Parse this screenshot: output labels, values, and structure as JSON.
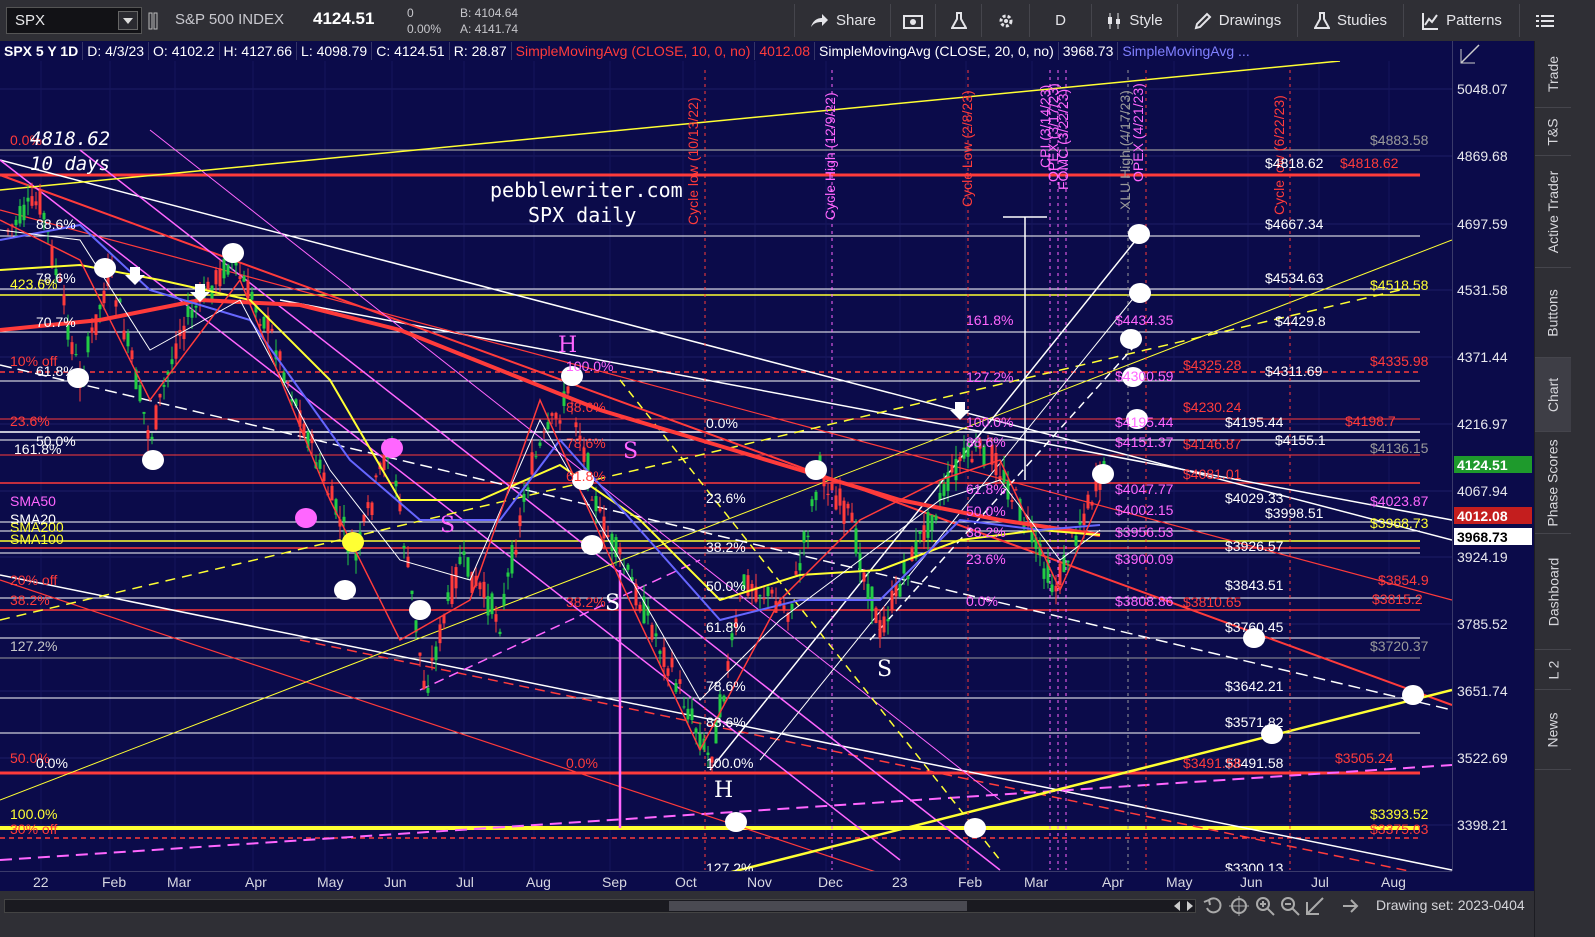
{
  "toolbar": {
    "symbol": "SPX",
    "index_name": "S&P 500 INDEX",
    "last": "4124.51",
    "change": "0",
    "change_pct": "0.00%",
    "bid": "B: 4104.64",
    "ask": "A: 4141.74",
    "share_label": "Share",
    "period_label": "D",
    "style_label": "Style",
    "drawings_label": "Drawings",
    "studies_label": "Studies",
    "patterns_label": "Patterns"
  },
  "info_bar": {
    "chart_desc": "SPX 5 Y 1D",
    "date": "D: 4/3/23",
    "open": "O: 4102.2",
    "high": "H: 4127.66",
    "low": "L: 4098.79",
    "close": "C: 4124.51",
    "range": "R: 28.87",
    "sma10": "SimpleMovingAvg (CLOSE, 10, 0, no)",
    "sma10_val": "4012.08",
    "sma20": "SimpleMovingAvg (CLOSE, 20, 0, no)",
    "sma20_val": "3968.73",
    "sma_more": "SimpleMovingAvg ..."
  },
  "watermark": {
    "line1": "pebblewriter.com",
    "line2": "SPX daily"
  },
  "price_axis": {
    "ticks": [
      "5048.07",
      "4869.68",
      "4697.59",
      "4531.58",
      "4371.44",
      "4216.97",
      "4067.94",
      "3924.19",
      "3785.52",
      "3651.74",
      "3522.69",
      "3398.21"
    ],
    "tags": [
      {
        "text": "4124.51",
        "bg": "#1e9a2c",
        "color": "#ffffff"
      },
      {
        "text": "4012.08",
        "bg": "#c41e1e",
        "color": "#ffffff"
      },
      {
        "text": "3968.73",
        "bg": "#ffffff",
        "color": "#000000"
      }
    ]
  },
  "time_axis": [
    "22",
    "Feb",
    "Mar",
    "Apr",
    "May",
    "Jun",
    "Jul",
    "Aug",
    "Sep",
    "Oct",
    "Nov",
    "Dec",
    "23",
    "Feb",
    "Mar",
    "Apr",
    "May",
    "Jun",
    "Jul",
    "Aug"
  ],
  "cycle_labels": {
    "oct": "Cycle low (10/13/22)",
    "dec": "Cycle High (12/9/22)",
    "feb": "Cycle Low (2/8/23)",
    "cpi": "CPI (3/14/23)",
    "opex1": "OPEX (3/17/23)",
    "fomc": "FOMC (3/22/23)",
    "xlu": "XLU High (4/17/23)",
    "opex2": "OPEX (4/21/23)",
    "jun": "Cycle low (6/22/23)"
  },
  "levels_right": [
    {
      "text": "$4883.58",
      "color": "#9a9a9a"
    },
    {
      "text": "$4818.62",
      "color": "#ffffff"
    },
    {
      "text": "$4818.62",
      "color": "#ff3b3b"
    },
    {
      "text": "$4667.34",
      "color": "#ffffff"
    },
    {
      "text": "$4534.63",
      "color": "#ffffff"
    },
    {
      "text": "$4518.58",
      "color": "#ffff33"
    },
    {
      "text": "$4434.35",
      "color": "#ff66ff"
    },
    {
      "text": "$4429.8",
      "color": "#ffffff"
    },
    {
      "text": "$4335.98",
      "color": "#ff3b3b"
    },
    {
      "text": "$4325.28",
      "color": "#ff3b3b"
    },
    {
      "text": "$4311.69",
      "color": "#ffffff"
    },
    {
      "text": "$4300.59",
      "color": "#ff66ff"
    },
    {
      "text": "$4230.24",
      "color": "#ff3b3b"
    },
    {
      "text": "$4198.7",
      "color": "#ff3b3b"
    },
    {
      "text": "$4195.44",
      "color": "#ffffff"
    },
    {
      "text": "$4195.44",
      "color": "#ff66ff"
    },
    {
      "text": "$4155.1",
      "color": "#ffffff"
    },
    {
      "text": "$4151.37",
      "color": "#ff66ff"
    },
    {
      "text": "$4146.87",
      "color": "#ff3b3b"
    },
    {
      "text": "$4136.15",
      "color": "#9a9a9a"
    },
    {
      "text": "$4081.01",
      "color": "#ff3b3b"
    },
    {
      "text": "$4047.77",
      "color": "#ff66ff"
    },
    {
      "text": "$4029.33",
      "color": "#ffffff"
    },
    {
      "text": "$4023.87",
      "color": "#ff66ff"
    },
    {
      "text": "$4002.15",
      "color": "#ff66ff"
    },
    {
      "text": "$3998.51",
      "color": "#ffffff"
    },
    {
      "text": "$3968.73",
      "color": "#ffff33"
    },
    {
      "text": "$3956.53",
      "color": "#ff66ff"
    },
    {
      "text": "$3926.57",
      "color": "#ffffff"
    },
    {
      "text": "$3900.09",
      "color": "#ff66ff"
    },
    {
      "text": "$3854.9",
      "color": "#ff3b3b"
    },
    {
      "text": "$3843.51",
      "color": "#ffffff"
    },
    {
      "text": "$3815.2",
      "color": "#ff3b3b"
    },
    {
      "text": "$3810.65",
      "color": "#ff3b3b"
    },
    {
      "text": "$3808.86",
      "color": "#ff66ff"
    },
    {
      "text": "$3760.45",
      "color": "#ffffff"
    },
    {
      "text": "$3720.37",
      "color": "#9a9a9a"
    },
    {
      "text": "$3642.21",
      "color": "#ffffff"
    },
    {
      "text": "$3571.82",
      "color": "#ffffff"
    },
    {
      "text": "$3505.24",
      "color": "#ff3b3b"
    },
    {
      "text": "$3491.58",
      "color": "#ffffff"
    },
    {
      "text": "$3491.58",
      "color": "#ff3b3b"
    },
    {
      "text": "$3393.52",
      "color": "#ffff33"
    },
    {
      "text": "$3375.03",
      "color": "#ff3b3b"
    },
    {
      "text": "$3300.13",
      "color": "#ffffff"
    }
  ],
  "fib_labels": [
    {
      "text": "0.0%",
      "color": "#ffffff"
    },
    {
      "text": "23.6%",
      "color": "#ffffff"
    },
    {
      "text": "38.2%",
      "color": "#ffffff"
    },
    {
      "text": "50.0%",
      "color": "#ffffff"
    },
    {
      "text": "61.8%",
      "color": "#ffffff"
    },
    {
      "text": "78.6%",
      "color": "#ffffff"
    },
    {
      "text": "83.6%",
      "color": "#ffffff"
    },
    {
      "text": "100.0%",
      "color": "#ffffff"
    },
    {
      "text": "127.2%",
      "color": "#ffffff"
    },
    {
      "text": "161.8%",
      "color": "#ff66ff"
    },
    {
      "text": "127.2%",
      "color": "#ff66ff"
    },
    {
      "text": "100.0%",
      "color": "#ff66ff"
    },
    {
      "text": "88.6%",
      "color": "#ff66ff"
    },
    {
      "text": "61.8%",
      "color": "#ff66ff"
    },
    {
      "text": "50.0%",
      "color": "#ff66ff"
    },
    {
      "text": "38.2%",
      "color": "#ff66ff"
    },
    {
      "text": "23.6%",
      "color": "#ff66ff"
    },
    {
      "text": "0.0%",
      "color": "#ff66ff"
    },
    {
      "text": "100.0%",
      "color": "#ff66ff"
    },
    {
      "text": "88.6%",
      "color": "#ff3b3b"
    },
    {
      "text": "78.6%",
      "color": "#ff3b3b"
    },
    {
      "text": "61.8%",
      "color": "#ff3b3b"
    },
    {
      "text": "38.2%",
      "color": "#ff3b3b"
    },
    {
      "text": "0.0%",
      "color": "#ff3b3b"
    },
    {
      "text": "88.6%",
      "color": "#ffffff"
    },
    {
      "text": "78.6%",
      "color": "#ffffff"
    },
    {
      "text": "70.7%",
      "color": "#ffffff"
    },
    {
      "text": "61.8%",
      "color": "#ffffff"
    },
    {
      "text": "50.0%",
      "color": "#ffffff"
    },
    {
      "text": "161.8%",
      "color": "#ffffff"
    },
    {
      "text": "423.6%",
      "color": "#ffff33"
    },
    {
      "text": "23.6%",
      "color": "#ff3b3b"
    },
    {
      "text": "20% off",
      "color": "#ff3b3b"
    },
    {
      "text": "38.2%",
      "color": "#ff3b3b"
    },
    {
      "text": "127.2%",
      "color": "#c8c8c8"
    },
    {
      "text": "50.0%",
      "color": "#ff3b3b"
    },
    {
      "text": "0.0%",
      "color": "#ffffff"
    },
    {
      "text": "100.0%",
      "color": "#ffff33"
    },
    {
      "text": "30% off",
      "color": "#ff3b3b"
    },
    {
      "text": "10% off",
      "color": "#ff3b3b"
    },
    {
      "text": "0.0%",
      "color": "#ff3b3b"
    },
    {
      "text": "SMA50",
      "color": "#ff66ff"
    },
    {
      "text": "SMA20",
      "color": "#ffffff"
    },
    {
      "text": "SMA200",
      "color": "#ffff33"
    },
    {
      "text": "SMA100",
      "color": "#ffff33"
    },
    {
      "text": "4818.62",
      "color": "#ffffff"
    },
    {
      "text": "10 days",
      "color": "#ffffff"
    }
  ],
  "pattern_letters": [
    {
      "text": "H",
      "color": "#ff66ff"
    },
    {
      "text": "S",
      "color": "#ff66ff"
    },
    {
      "text": "S",
      "color": "#ff66ff"
    },
    {
      "text": "S",
      "color": "#ffffff"
    },
    {
      "text": "H",
      "color": "#ffffff"
    },
    {
      "text": "S",
      "color": "#ffffff"
    }
  ],
  "right_tabs": [
    "Trade",
    "T&S",
    "Active Trader",
    "Buttons",
    "Chart",
    "Phase Scores",
    "Dashboard",
    "L 2",
    "News"
  ],
  "bottom_bar": {
    "drawing_set": "Drawing set: 2023-0404"
  }
}
